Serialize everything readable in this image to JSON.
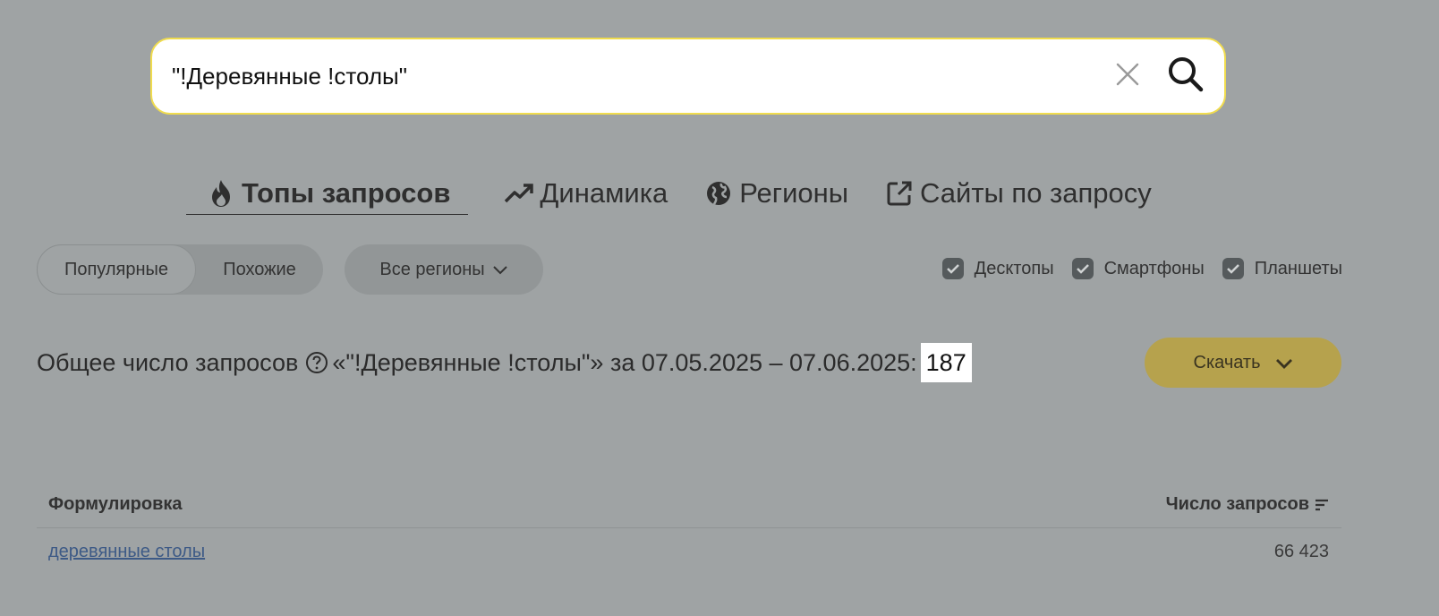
{
  "search": {
    "value": "\"!Деревянные !столы\"",
    "clear_icon": "close-icon",
    "search_icon": "search-icon"
  },
  "tabs": [
    {
      "label": "Топы запросов",
      "icon": "fire-icon",
      "active": true
    },
    {
      "label": "Динамика",
      "icon": "trend-icon",
      "active": false
    },
    {
      "label": "Регионы",
      "icon": "globe-icon",
      "active": false
    },
    {
      "label": "Сайты по запросу",
      "icon": "external-link-icon",
      "active": false
    }
  ],
  "filters": {
    "popular": "Популярные",
    "similar": "Похожие",
    "regions": "Все регионы"
  },
  "devices": {
    "desktop": "Десктопы",
    "smartphone": "Смартфоны",
    "tablet": "Планшеты"
  },
  "summary": {
    "prefix": "Общее число запросов",
    "query": "«\"!Деревянные !столы\"»",
    "period": "за 07.05.2025 – 07.06.2025:",
    "total": "187"
  },
  "download": {
    "label": "Скачать"
  },
  "table": {
    "col_phrase": "Формулировка",
    "col_count": "Число запросов",
    "rows": [
      {
        "phrase": "деревянные столы",
        "count": "66 423"
      }
    ]
  },
  "colors": {
    "background": "#9fa3a4",
    "search_border": "#f0dc4e",
    "download": "#b6a24d",
    "link": "#3d5a86"
  }
}
